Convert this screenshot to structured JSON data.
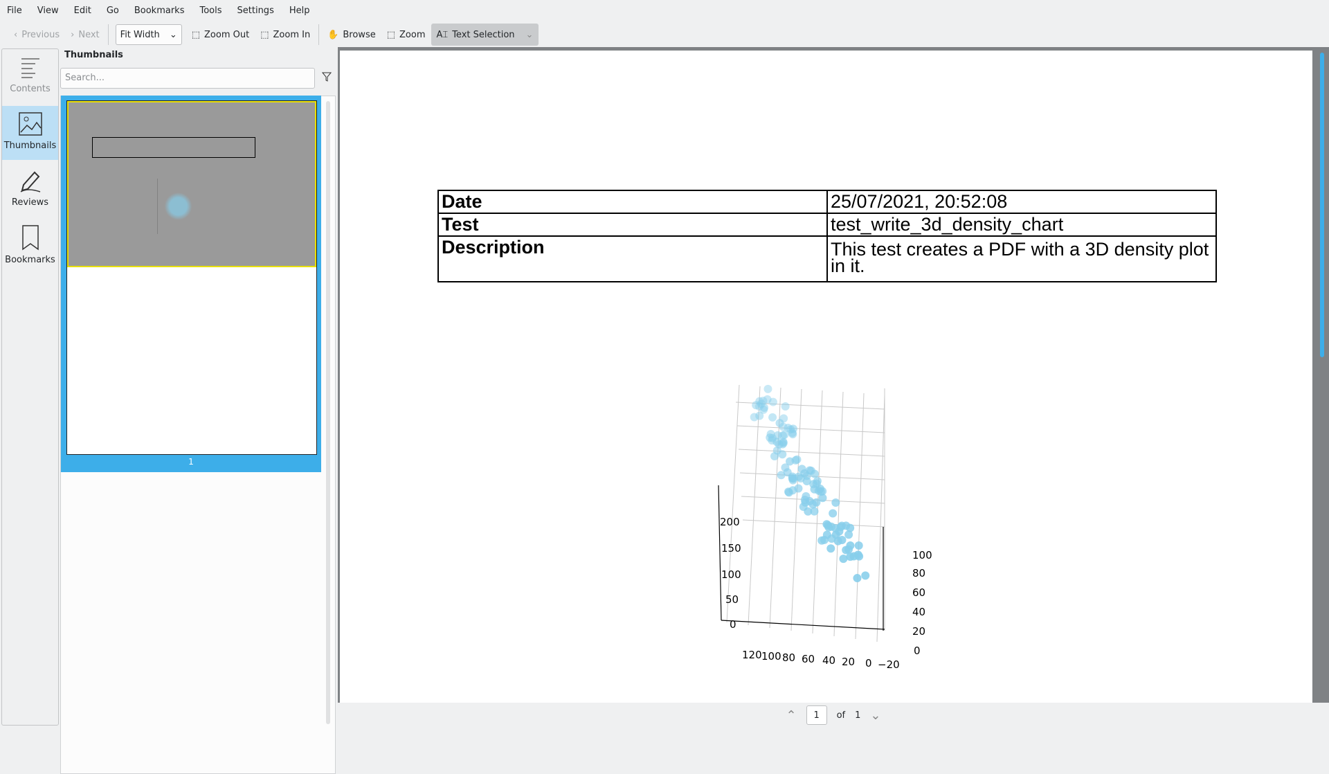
{
  "menu": [
    "File",
    "View",
    "Edit",
    "Go",
    "Bookmarks",
    "Tools",
    "Settings",
    "Help"
  ],
  "toolbar": {
    "previous": "Previous",
    "next": "Next",
    "zoom_mode": "Fit Width",
    "zoom_out": "Zoom Out",
    "zoom_in": "Zoom In",
    "browse": "Browse",
    "zoom": "Zoom",
    "text_selection": "Text Selection"
  },
  "sidebar": {
    "items": [
      {
        "label": "Contents"
      },
      {
        "label": "Thumbnails"
      },
      {
        "label": "Reviews"
      },
      {
        "label": "Bookmarks"
      }
    ]
  },
  "thumbnails": {
    "title": "Thumbnails",
    "search_placeholder": "Search...",
    "page_number": "1"
  },
  "document": {
    "rows": [
      {
        "key": "Date",
        "value": "25/07/2021, 20:52:08"
      },
      {
        "key": "Test",
        "value": "test_write_3d_density_chart"
      },
      {
        "key": "Description",
        "value": "This test creates a PDF with a 3D density plot in it."
      }
    ],
    "plot": {
      "z_ticks": [
        "200",
        "150",
        "100",
        "50",
        "0"
      ],
      "y_ticks": [
        "100",
        "80",
        "60",
        "40",
        "20",
        "0"
      ],
      "x_ticks": [
        "120",
        "100",
        "80",
        "60",
        "40",
        "20",
        "0",
        "−20"
      ],
      "point_color": "#87ceeb"
    }
  },
  "pagenav": {
    "current": "1",
    "of": "of",
    "total": "1"
  }
}
